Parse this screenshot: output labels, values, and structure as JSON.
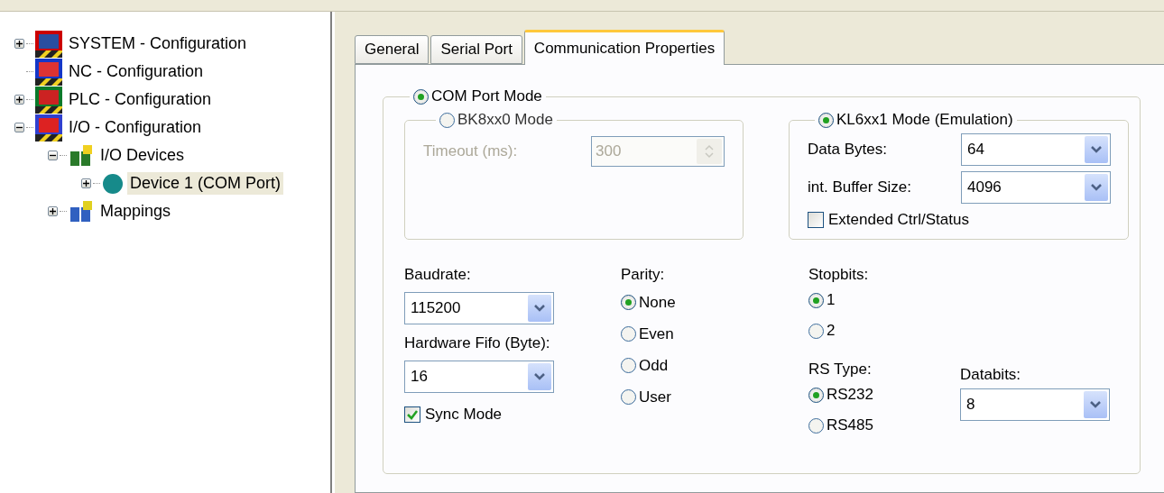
{
  "tree": [
    {
      "label": "SYSTEM - Configuration",
      "kind": "system",
      "expanded": false,
      "selected": false
    },
    {
      "label": "NC - Configuration",
      "kind": "nc",
      "selected": false
    },
    {
      "label": "PLC - Configuration",
      "kind": "plc",
      "expanded": false,
      "selected": false
    },
    {
      "label": "I/O - Configuration",
      "kind": "io",
      "expanded": true,
      "selected": false,
      "children": [
        {
          "label": "I/O Devices",
          "kind": "devices",
          "expanded": true,
          "selected": false,
          "children": [
            {
              "label": "Device 1 (COM Port)",
              "kind": "device",
              "expanded": false,
              "selected": true
            }
          ]
        },
        {
          "label": "Mappings",
          "kind": "mappings",
          "expanded": false,
          "selected": false
        }
      ]
    }
  ],
  "tabs": [
    {
      "label": "General",
      "selected": false
    },
    {
      "label": "Serial Port",
      "selected": false
    },
    {
      "label": "Communication Properties",
      "selected": true
    }
  ],
  "com_port_mode": {
    "label": "COM Port Mode",
    "selected": true
  },
  "bk_mode": {
    "label": "BK8xx0 Mode",
    "selected": false,
    "disabled": true,
    "timeout": {
      "label": "Timeout (ms):",
      "value": "300"
    }
  },
  "kl_mode": {
    "label": "KL6xx1 Mode (Emulation)",
    "selected": true,
    "data_bytes": {
      "label": "Data Bytes:",
      "value": "64"
    },
    "buffer_size": {
      "label": "int. Buffer Size:",
      "value": "4096"
    },
    "extended": {
      "label": "Extended Ctrl/Status",
      "checked": false
    }
  },
  "baudrate": {
    "label": "Baudrate:",
    "value": "115200"
  },
  "fifo": {
    "label": "Hardware Fifo (Byte):",
    "value": "16"
  },
  "sync_mode": {
    "label": "Sync Mode",
    "checked": true
  },
  "parity": {
    "label": "Parity:",
    "options": [
      {
        "label": "None",
        "selected": true
      },
      {
        "label": "Even",
        "selected": false
      },
      {
        "label": "Odd",
        "selected": false
      },
      {
        "label": "User",
        "selected": false
      }
    ]
  },
  "stopbits": {
    "label": "Stopbits:",
    "options": [
      {
        "label": "1",
        "selected": true
      },
      {
        "label": "2",
        "selected": false
      }
    ]
  },
  "rs_type": {
    "label": "RS Type:",
    "options": [
      {
        "label": "RS232",
        "selected": true
      },
      {
        "label": "RS485",
        "selected": false
      }
    ]
  },
  "databits": {
    "label": "Databits:",
    "value": "8"
  }
}
